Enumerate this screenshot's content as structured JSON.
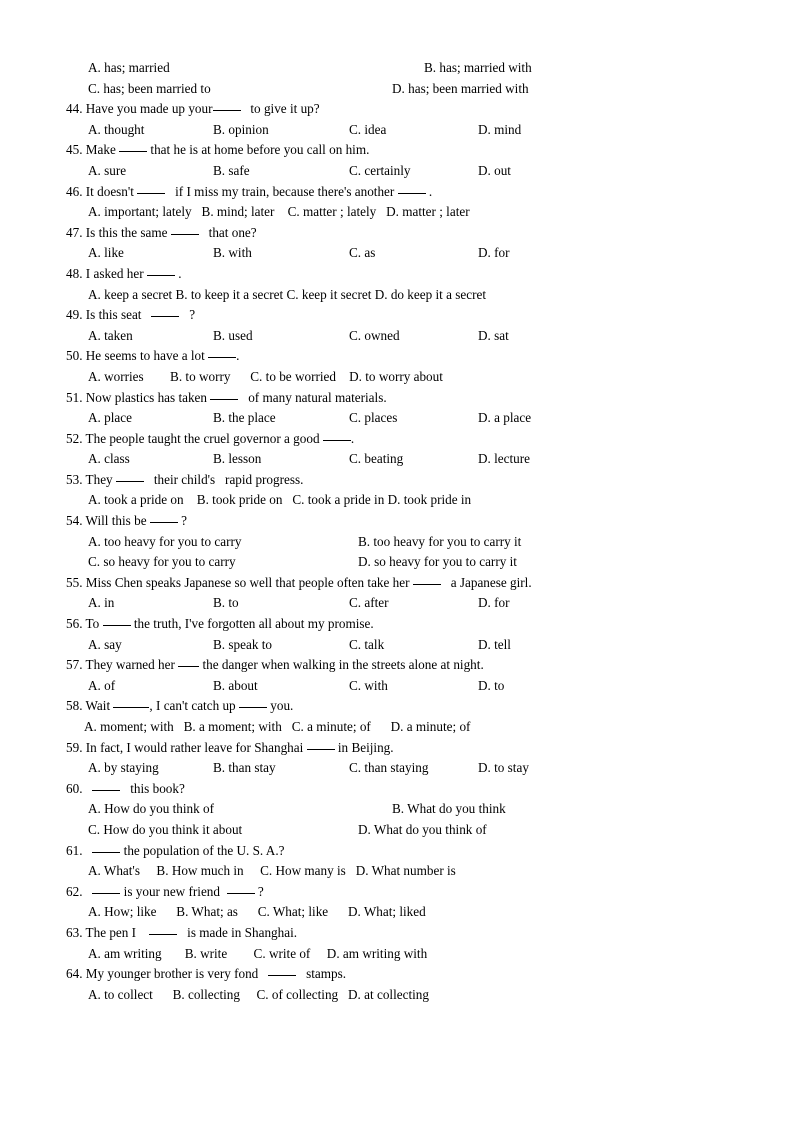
{
  "document": {
    "type": "english-grammar-multiple-choice-worksheet",
    "page_background": "#ffffff",
    "text_color": "#000000"
  },
  "orphan_options": {
    "a": "A. has; married",
    "b": "B. has; married with",
    "c": "C. has; been married to",
    "d": "D. has; been married with"
  },
  "questions": [
    {
      "number": "44.",
      "stem_pre": "44. Have you made up your",
      "stem_post": "to give it up?",
      "layout": "four-column",
      "options": [
        "A. thought",
        "B. opinion",
        "C. idea",
        "D. mind"
      ]
    },
    {
      "number": "45.",
      "stem_pre": "45. Make",
      "stem_post": "that he is at home before you call on him.",
      "layout": "four-column",
      "options": [
        "A. sure",
        "B. safe",
        "C. certainly",
        "D. out"
      ]
    },
    {
      "number": "46.",
      "stem_pre": "46. It doesn't",
      "stem_mid": "if I miss my train, because there's another",
      "stem_post": ".",
      "layout": "flow",
      "options_text": "A. important; lately   B. mind; later    C. matter ; lately   D. matter ; later"
    },
    {
      "number": "47.",
      "stem_pre": "47. Is this the same",
      "stem_post": "that one?",
      "layout": "four-column",
      "options": [
        "A. like",
        "B. with",
        "C. as",
        "D. for"
      ]
    },
    {
      "number": "48.",
      "stem_pre": "48. I asked her",
      "stem_post": ".",
      "layout": "flow",
      "options_text": "A. keep a secret B. to keep it a secret C. keep it secret D. do keep it a secret"
    },
    {
      "number": "49.",
      "stem_pre": "49. Is this seat",
      "stem_post": "?",
      "layout": "four-column",
      "options": [
        "A. taken",
        "B. used",
        "C. owned",
        "D. sat"
      ]
    },
    {
      "number": "50.",
      "stem_pre": "50. He seems to have a lot",
      "stem_post": ".",
      "layout": "flow",
      "options_text": "A. worries        B. to worry      C. to be worried    D. to worry about"
    },
    {
      "number": "51.",
      "stem_pre": "51. Now plastics has taken",
      "stem_post": "of many natural materials.",
      "layout": "four-column",
      "options": [
        "A. place",
        "B. the place",
        "C. places",
        "D. a place"
      ]
    },
    {
      "number": "52.",
      "stem_pre": "52. The people taught the cruel governor a good",
      "stem_post": ".",
      "layout": "four-column",
      "options": [
        "A. class",
        "B. lesson",
        "C. beating",
        "D. lecture"
      ]
    },
    {
      "number": "53.",
      "stem_pre": "53. They",
      "stem_post": "their child's   rapid progress.",
      "layout": "flow",
      "options_text": "A. took a pride on    B. took pride on   C. took a pride in D. took pride in"
    },
    {
      "number": "54.",
      "stem_pre": "54. Will this be",
      "stem_post": "?",
      "layout": "two-column",
      "options": [
        "A. too heavy for you to carry",
        "B. too heavy for you to carry it",
        "C. so heavy for you to carry",
        "D. so heavy for you to carry it"
      ]
    },
    {
      "number": "55.",
      "stem_pre": "55. Miss Chen speaks Japanese so well that people often take her",
      "stem_post": "a Japanese girl.",
      "layout": "four-column",
      "options": [
        "A. in",
        "B. to",
        "C. after",
        "D. for"
      ]
    },
    {
      "number": "56.",
      "stem_pre": "56. To",
      "stem_post": "the truth, I've forgotten all about my promise.",
      "layout": "four-column",
      "options": [
        "A. say",
        "B. speak to",
        "C. talk",
        "D. tell"
      ]
    },
    {
      "number": "57.",
      "stem_pre": "57. They warned her",
      "stem_post": "the danger when walking in the streets alone at night.",
      "layout": "four-column",
      "options": [
        "A. of",
        "B. about",
        "C. with",
        "D. to"
      ]
    },
    {
      "number": "58.",
      "stem_pre": "58. Wait",
      "stem_mid": ", I can't catch up",
      "stem_post": "you.",
      "layout": "flow",
      "options_text": "A. moment; with   B. a moment; with   C. a minute; of      D. a minute; of"
    },
    {
      "number": "59.",
      "stem_pre": "59. In fact, I would rather leave for Shanghai",
      "stem_post": "in Beijing.",
      "layout": "four-column",
      "options": [
        "A. by staying",
        "B. than stay",
        "C. than staying",
        "D. to stay"
      ]
    },
    {
      "number": "60.",
      "stem_pre": "60.",
      "stem_post": "this book?",
      "layout": "two-column-60",
      "options": [
        "A. How do you think of",
        "B. What do you think",
        "C. How do you think it about",
        "D. What do you think of"
      ]
    },
    {
      "number": "61.",
      "stem_pre": "61.",
      "stem_post": "the population of the U. S. A.?",
      "layout": "flow",
      "options_text": "A. What's     B. How much in     C. How many is   D. What number is"
    },
    {
      "number": "62.",
      "stem_pre": "62.",
      "stem_mid": "is your new friend",
      "stem_post": "?",
      "layout": "flow",
      "options_text": "A. How; like      B. What; as      C. What; like      D. What; liked"
    },
    {
      "number": "63.",
      "stem_pre": "63. The pen I",
      "stem_post": "is made in Shanghai.",
      "layout": "flow",
      "options_text": "A. am writing       B. write        C. write of     D. am writing with"
    },
    {
      "number": "64.",
      "stem_pre": "64. My younger brother is very fond",
      "stem_post": "stamps.",
      "layout": "flow",
      "options_text": "A. to collect      B. collecting     C. of collecting   D. at collecting"
    }
  ]
}
